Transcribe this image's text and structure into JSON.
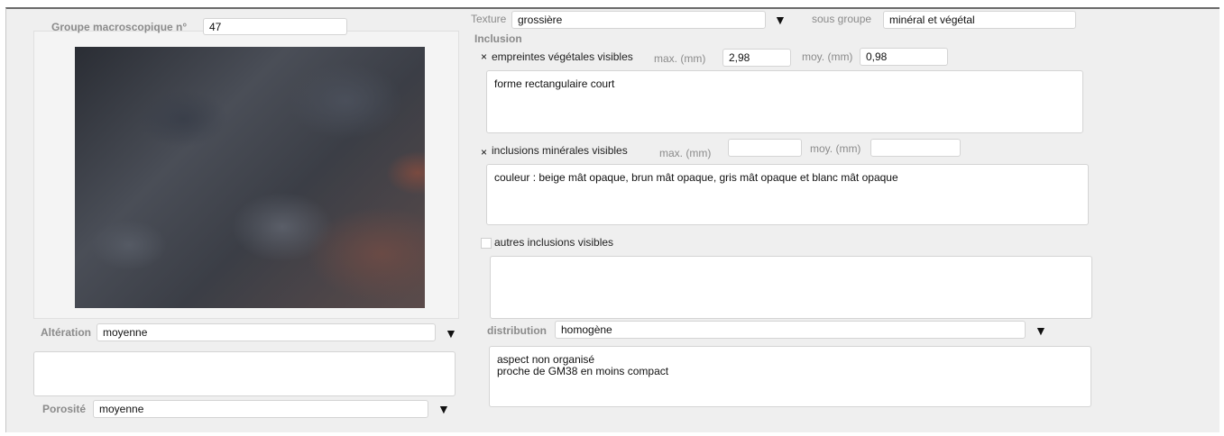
{
  "left": {
    "group_label": "Groupe macroscopique n°",
    "group_value": "47",
    "alteration_label": "Altération",
    "alteration_value": "moyenne",
    "alteration_note": "",
    "porosite_label": "Porosité",
    "porosite_value": "moyenne"
  },
  "right": {
    "texture_label": "Texture",
    "texture_value": "grossière",
    "sous_groupe_label": "sous groupe",
    "sous_groupe_value": "minéral et végétal",
    "inclusion_heading": "Inclusion",
    "empreintes": {
      "checked": true,
      "label": "empreintes végétales visibles",
      "max_label": "max. (mm)",
      "max_value": "2,98",
      "moy_label": "moy. (mm)",
      "moy_value": "0,98",
      "note": "forme rectangulaire court"
    },
    "minerales": {
      "checked": true,
      "label": "inclusions minérales visibles",
      "max_label": "max. (mm)",
      "max_value": "",
      "moy_label": "moy. (mm)",
      "moy_value": "",
      "note": "couleur : beige mât opaque, brun mât opaque, gris mât opaque et blanc mât opaque"
    },
    "autres": {
      "checked": false,
      "label": "autres inclusions visibles",
      "note": ""
    },
    "distribution_label": "distribution",
    "distribution_value": "homogène",
    "distribution_note": "aspect non organisé\nproche de GM38 en moins compact"
  },
  "icons": {
    "dropdown": "▼",
    "check": "×"
  }
}
